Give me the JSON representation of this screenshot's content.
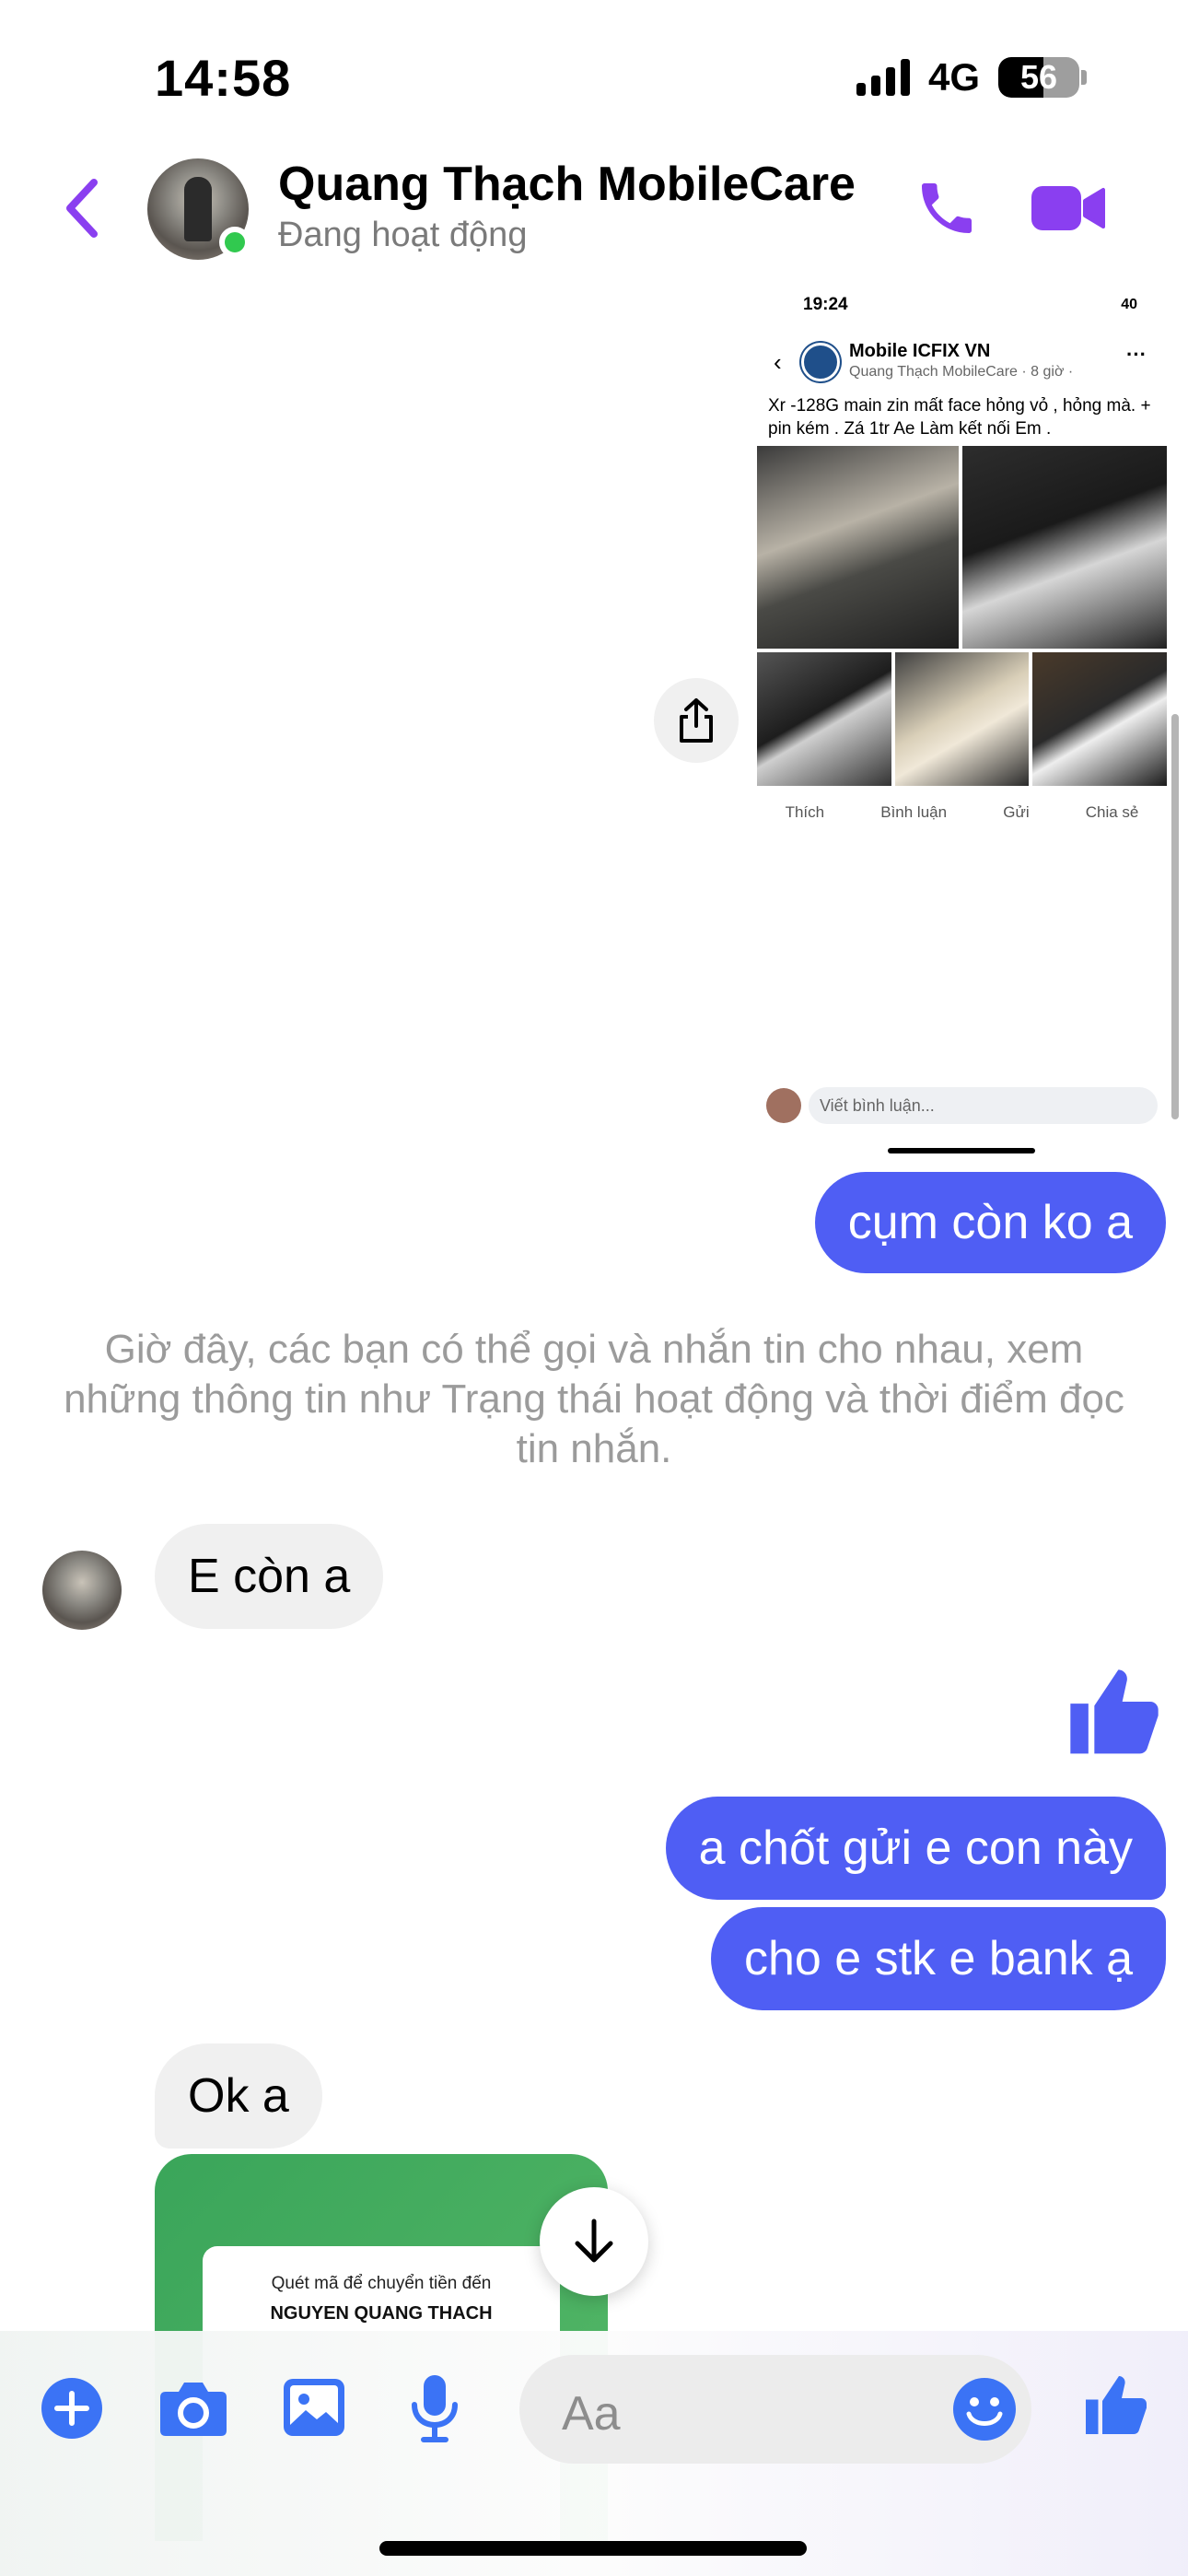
{
  "status_bar": {
    "time": "14:58",
    "network": "4G",
    "battery": "56",
    "battery_level": 0.56
  },
  "header": {
    "name": "Quang Thạch MobileCare",
    "status": "Đang hoạt động"
  },
  "shared_post": {
    "status_time": "19:24",
    "status_battery": "40",
    "page_name": "Mobile ICFIX VN",
    "poster": "Quang Thạch MobileCare · 8 giờ ·",
    "caption": "Xr -128G main zin mất face hỏng vỏ , hỏng mà. + pin kém . Zá 1tr Ae Làm kết nối Em .",
    "actions": [
      "Thích",
      "Bình luận",
      "Gửi",
      "Chia sẻ"
    ],
    "comment_placeholder": "Viết bình luận..."
  },
  "messages": {
    "m1": "cụm còn ko a",
    "info": "Giờ đây, các bạn có thể gọi và nhắn tin cho nhau, xem những thông tin như Trạng thái hoạt động và thời điểm đọc tin nhắn.",
    "m2": "E còn a",
    "m3": "a chốt gửi e con này",
    "m4": "cho e stk e bank ạ",
    "m5": "Ok a",
    "qr_line1": "Quét mã để chuyển tiền đến",
    "qr_line2": "NGUYEN QUANG THACH"
  },
  "composer": {
    "placeholder": "Aa"
  },
  "colors": {
    "accent": "#4f5ef4",
    "header_icons": "#8a3ff0",
    "composer_icons": "#3b73f5",
    "online": "#31c94f"
  }
}
